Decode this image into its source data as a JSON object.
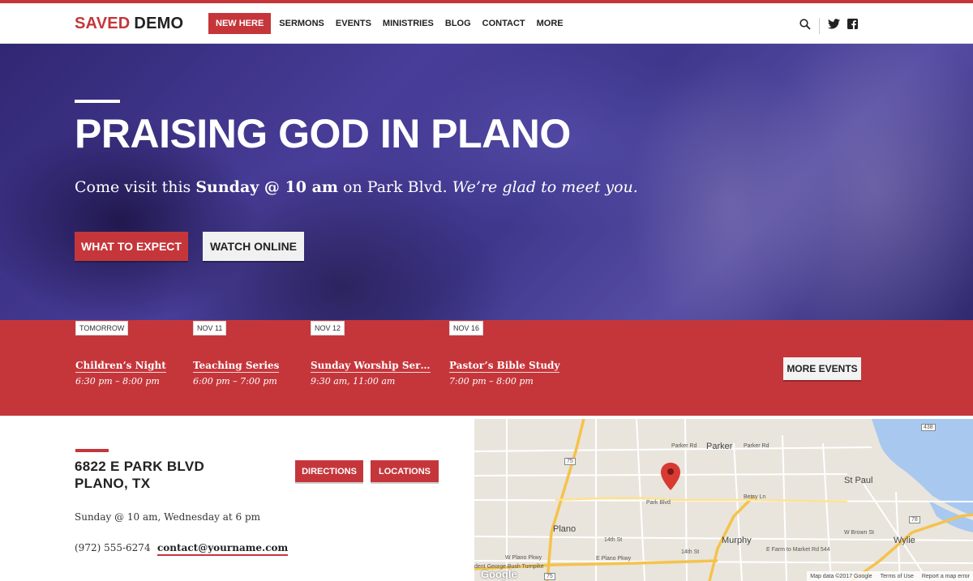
{
  "header": {
    "logo_a": "SAVED",
    "logo_b": "DEMO",
    "new_here": "NEW HERE",
    "nav": [
      "SERMONS",
      "EVENTS",
      "MINISTRIES",
      "BLOG",
      "CONTACT",
      "MORE"
    ]
  },
  "hero": {
    "title": "PRAISING GOD IN PLANO",
    "sub_a": "Come visit this ",
    "sub_b": "Sunday @ 10 am",
    "sub_c": " on Park Blvd. ",
    "sub_d": "We’re glad to meet you.",
    "btn_primary": "WHAT TO EXPECT",
    "btn_secondary": "WATCH ONLINE"
  },
  "events": {
    "items": [
      {
        "date": "TOMORROW",
        "name": "Children’s Night",
        "time": "6:30 pm – 8:00 pm"
      },
      {
        "date": "NOV 11",
        "name": "Teaching Series",
        "time": "6:00 pm – 7:00 pm"
      },
      {
        "date": "NOV 12",
        "name": "Sunday Worship Ser…",
        "time": "9:30 am, 11:00 am"
      },
      {
        "date": "NOV 16",
        "name": "Pastor’s Bible Study",
        "time": "7:00 pm – 8:00 pm"
      }
    ],
    "more": "MORE EVENTS"
  },
  "location": {
    "addr_line1": "6822 E PARK BLVD",
    "addr_line2": "PLANO, TX",
    "btn_directions": "DIRECTIONS",
    "btn_locations": "LOCATIONS",
    "times": "Sunday @ 10 am, Wednesday at 6 pm",
    "phone": "(972) 555-6274",
    "email": "contact@yourname.com"
  },
  "map": {
    "labels": {
      "parker": "Parker",
      "parker_rd": "Parker Rd",
      "parker_rd2": "Parker Rd",
      "st_paul": "St Paul",
      "plano": "Plano",
      "murphy": "Murphy",
      "wylie": "Wylie",
      "park_blvd": "Park Blvd",
      "betsy": "Betsy Ln",
      "w_brown": "W Brown St",
      "e_farm": "E Farm to Market Rd 544",
      "e_plano": "E Plano Pkwy",
      "w_plano": "W Plano Pkwy",
      "pres_george": "dent George Bush Turnpike",
      "fourteenth": "14th St",
      "fourteenth2": "14th St",
      "r75": "75",
      "r75b": "75",
      "r78": "78",
      "r438": "438"
    },
    "footer": [
      "Map data ©2017 Google",
      "Terms of Use",
      "Report a map error"
    ],
    "google": "Google"
  }
}
